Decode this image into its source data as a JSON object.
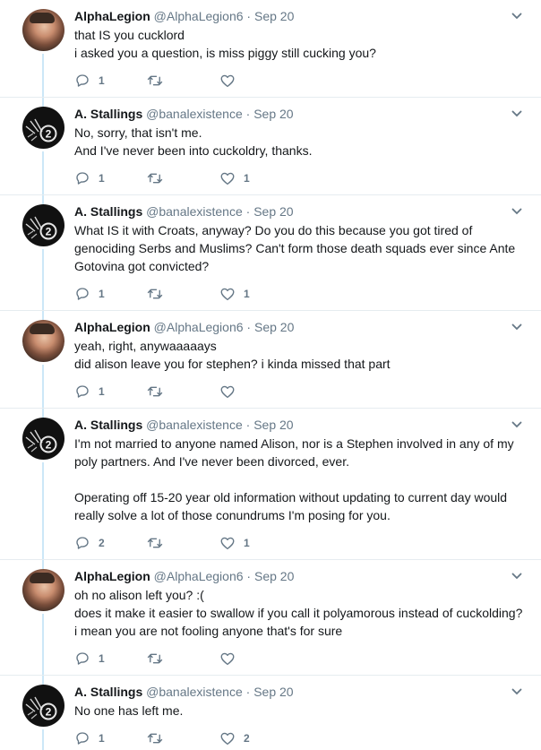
{
  "colors": {
    "text": "#14171a",
    "secondary": "#657786",
    "thread_line": "#cce7f7",
    "divider": "#e6ecf0"
  },
  "tweets": [
    {
      "name": "AlphaLegion",
      "handle": "@AlphaLegion6",
      "date": "Sep 20",
      "avatar": "alpha-avatar",
      "lines": [
        "that IS you cucklord",
        "i asked you a question, is miss piggy still cucking you?"
      ],
      "replies": "1",
      "retweets": "",
      "likes": ""
    },
    {
      "name": "A. Stallings",
      "handle": "@banalexistence",
      "date": "Sep 20",
      "avatar": "stallings-avatar",
      "lines": [
        "No, sorry, that isn't me.",
        "And I've never been into cuckoldry, thanks."
      ],
      "replies": "1",
      "retweets": "",
      "likes": "1"
    },
    {
      "name": "A. Stallings",
      "handle": "@banalexistence",
      "date": "Sep 20",
      "avatar": "stallings-avatar",
      "lines": [
        "What IS it with Croats, anyway? Do you do this because you got tired of",
        "genociding Serbs and Muslims? Can't form those death squads ever since Ante",
        "Gotovina got convicted?"
      ],
      "replies": "1",
      "retweets": "",
      "likes": "1"
    },
    {
      "name": "AlphaLegion",
      "handle": "@AlphaLegion6",
      "date": "Sep 20",
      "avatar": "alpha-avatar",
      "lines": [
        "yeah, right, anywaaaaays",
        "did alison leave you for stephen? i kinda missed that part"
      ],
      "replies": "1",
      "retweets": "",
      "likes": ""
    },
    {
      "name": "A. Stallings",
      "handle": "@banalexistence",
      "date": "Sep 20",
      "avatar": "stallings-avatar",
      "lines": [
        "I'm not married to anyone named Alison, nor is a Stephen involved in any of my",
        "poly partners. And I've never been divorced, ever.",
        "",
        "Operating off 15-20 year old information without updating to current day would",
        "really solve a lot of those conundrums I'm posing for you."
      ],
      "replies": "2",
      "retweets": "",
      "likes": "1"
    },
    {
      "name": "AlphaLegion",
      "handle": "@AlphaLegion6",
      "date": "Sep 20",
      "avatar": "alpha-avatar",
      "lines": [
        "oh no alison left you? :(",
        "does it make it easier to swallow if you call it polyamorous instead of cuckolding?",
        "i mean you are not fooling anyone that's for sure"
      ],
      "replies": "1",
      "retweets": "",
      "likes": ""
    },
    {
      "name": "A. Stallings",
      "handle": "@banalexistence",
      "date": "Sep 20",
      "avatar": "stallings-avatar",
      "lines": [
        "No one has left me."
      ],
      "replies": "1",
      "retweets": "",
      "likes": "2"
    }
  ]
}
